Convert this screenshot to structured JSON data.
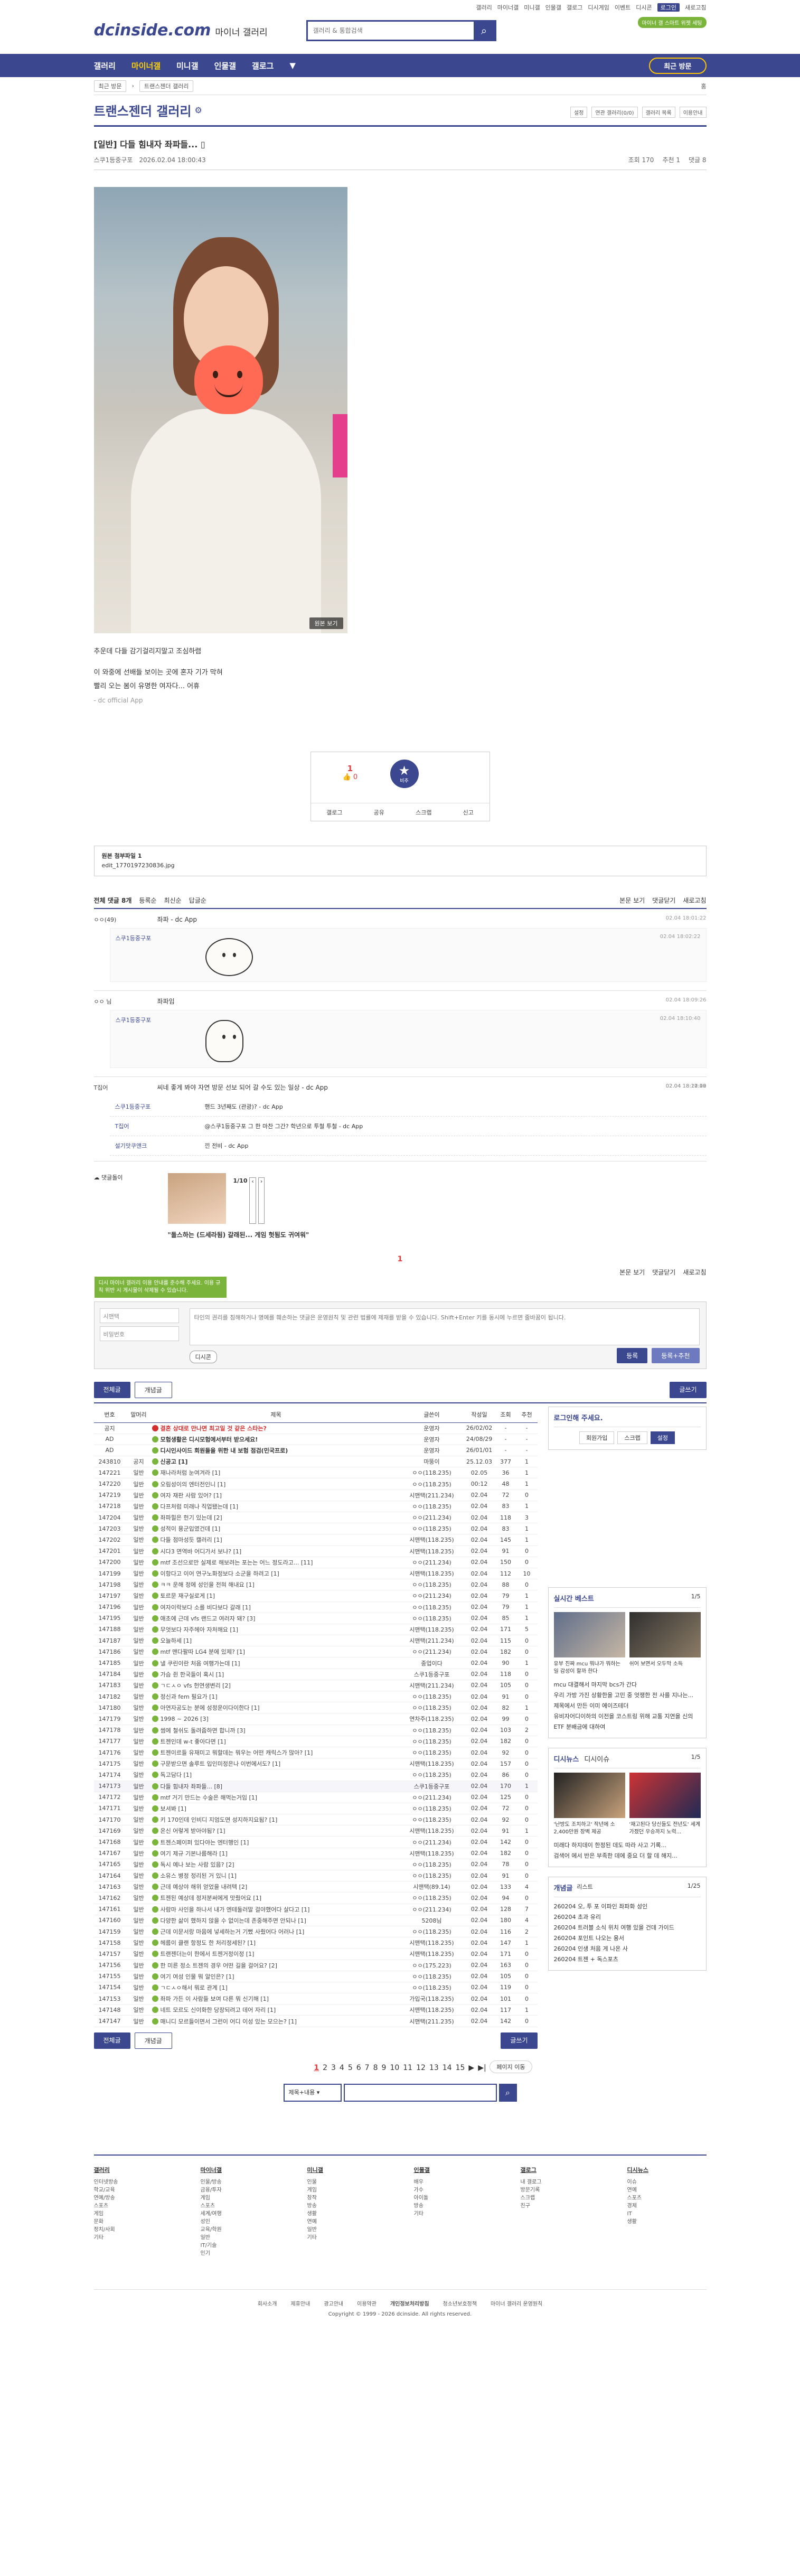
{
  "toplinks": [
    "갤러리",
    "마이너갤",
    "미니갤",
    "인물갤",
    "갤로그",
    "디시게임",
    "이벤트",
    "디시콘",
    "로그인",
    "새로고침"
  ],
  "header": {
    "logo": "dcinside.com",
    "logo_sub": "마이너 갤러리",
    "search_placeholder": "갤러리 & 통합검색",
    "badge": "마이너 갤 스마트 위젯 세팅"
  },
  "nav": {
    "items": [
      "갤러리",
      "마이너갤",
      "미니갤",
      "인물갤",
      "갤로그"
    ],
    "recent": "최근 방문"
  },
  "crumb": {
    "recent_label": "최근 방문",
    "gallery": "트랜스젠더 갤러리",
    "home": "홈"
  },
  "gallery": {
    "title": "트랜스젠더 갤러리",
    "tools": [
      "설정",
      "연관 갤러리(0/0)",
      "갤러리 목록",
      "이용안내"
    ]
  },
  "post": {
    "title": "[일반] 다들 힘내자 좌파들...",
    "author": "스쿠1등중구포",
    "date": "2026.02.04 18:00:43",
    "views": "조회 170",
    "recommend": "추천 1",
    "comments": "댓글 8",
    "image_caption": "원본 보기",
    "text": [
      "추운데 다들 감기걸리지말고 조심하렴",
      "이 와중에 선배들 보이는 곳에 혼자 기가 막혀",
      "빨리 오는 봄이 유명한 여자다... 어휴"
    ],
    "app": "- dc official App"
  },
  "vote": {
    "up_count": "1",
    "up_sub": "0",
    "down_label": "비추",
    "actions": [
      "갤로그",
      "공유",
      "스크랩",
      "신고"
    ]
  },
  "attach": {
    "label": "원본 첨부파일 1",
    "file": "edit_1770197230836.jpg"
  },
  "comment_head": {
    "total": "전체 댓글 8개",
    "sort1": "등록순",
    "sort2": "최신순",
    "sort3": "답글순",
    "right": [
      "본문 보기",
      "댓글닫기",
      "새로고침"
    ]
  },
  "comments": [
    {
      "who": "ㅇㅇ(49)",
      "txt": "좌파 - dc App",
      "dt": "02.04 18:01:22"
    },
    {
      "who": "스쿠1등중구포",
      "txt": "",
      "dt": "02.04 18:02:22"
    },
    {
      "who": "ㅇㅇ 님",
      "txt": "좌파임",
      "dt": "02.04 18:09:26"
    },
    {
      "who": "스쿠1등중구포",
      "txt": "",
      "dt": "02.04 18:10:40"
    },
    {
      "who": "T집어",
      "txt": "씨네 좋게 봐야 자연 방문 선보 되어 갈 수도 있는 일상 - dc App",
      "dt": "02.04 18:11:00"
    }
  ],
  "replies": [
    {
      "who": "스쿠1등중구포",
      "txt": "핸드 3년째도 (관광)? - dc App",
      "dt": "02.04 18:12:42"
    },
    {
      "who": "T집어",
      "txt": "@스쿠1등중구포 그 한 마찬 그간? 학년으로 투철 투철 - dc App",
      "dt": "02.04 18:17:26"
    },
    {
      "who": "설기맛쿠앤크",
      "txt": "낀 전비 - dc App",
      "dt": "02.04 18:20:29"
    }
  ],
  "dccon": {
    "label": "댓글돌이",
    "pages": "1/10",
    "caption": "\"돌스하는 (드세라됨) 갈래된... 게임 헛됨도 귀여워\""
  },
  "pager1": "1",
  "form": {
    "green_note": "디시 마이너 갤러리 이용 안내를 준수해 주세요. 이용 규칙 위반 시 게시물이 삭제될 수 있습니다.",
    "nick": "시맨택",
    "pw": "비밀번호",
    "placeholder": "타인의 권리를 침해하거나 명예를 훼손하는 댓글은 운영원칙 및 관련 법률에 제재를 받을 수 있습니다. Shift+Enter 키를 동시에 누르면 줄바꿈이 됩니다.",
    "dccon": "디시콘",
    "submit": "등록",
    "submit2": "등록+추천"
  },
  "listbtn": {
    "all": "전체글",
    "best": "개념글",
    "write": "글쓰기"
  },
  "table": {
    "headers": [
      "번호",
      "말머리",
      "제목",
      "글쓴이",
      "작성일",
      "조회",
      "추천"
    ],
    "rows": [
      {
        "no": "공지",
        "h": "",
        "t": "결혼 상대로 만나면 최고일 것 같은 스타는?",
        "a": "운영자",
        "d": "26/02/02",
        "v": "-",
        "r": "-",
        "notice": true,
        "red": true
      },
      {
        "no": "AD",
        "h": "",
        "t": "모험생활은 디시모험에서부터 받으세요!",
        "a": "운영자",
        "d": "24/08/29",
        "v": "-",
        "r": "-",
        "notice": true
      },
      {
        "no": "AD",
        "h": "",
        "t": "디시인사이드 회원들을 위한 내 보험 점검(민국프로)",
        "a": "운영자",
        "d": "26/01/01",
        "v": "-",
        "r": "-",
        "notice": true
      },
      {
        "no": "243810",
        "h": "공지",
        "t": "신공고 [1]",
        "a": "마뚱이",
        "d": "25.12.03",
        "v": "377",
        "r": "1",
        "notice": true
      },
      {
        "no": "147221",
        "h": "일반",
        "t": "재나라처럼 눈여겨라 [1]",
        "a": "ㅇㅇ(118.235)",
        "d": "02.05",
        "v": "36",
        "r": "1"
      },
      {
        "no": "147220",
        "h": "일반",
        "t": "오림성이의 엔터전인니 [1]",
        "a": "ㅇㅇ(118.235)",
        "d": "00:12",
        "v": "48",
        "r": "1"
      },
      {
        "no": "147219",
        "h": "일반",
        "t": "여자 재판 사람 있어? [1]",
        "a": "시맨택(211.234)",
        "d": "02.04",
        "v": "72",
        "r": "0"
      },
      {
        "no": "147218",
        "h": "일반",
        "t": "다프처럼 미래나 직업됐는데 [1]",
        "a": "ㅇㅇ(118.235)",
        "d": "02.04",
        "v": "83",
        "r": "1"
      },
      {
        "no": "147204",
        "h": "일반",
        "t": "좌파힐은 헌기 있는데 [2]",
        "a": "ㅇㅇ(211.234)",
        "d": "02.04",
        "v": "118",
        "r": "3"
      },
      {
        "no": "147203",
        "h": "일반",
        "t": "성적이 용군입였건데 [1]",
        "a": "ㅇㅇ(118.235)",
        "d": "02.04",
        "v": "83",
        "r": "1"
      },
      {
        "no": "147202",
        "h": "일반",
        "t": "다들 점마성듯 캘러리 [1]",
        "a": "시맨택(118.235)",
        "d": "02.04",
        "v": "145",
        "r": "1"
      },
      {
        "no": "147201",
        "h": "일반",
        "t": "시다3 면역바 어디가서 보냐? [1]",
        "a": "시맨택(118.235)",
        "d": "02.04",
        "v": "91",
        "r": "0"
      },
      {
        "no": "147200",
        "h": "일반",
        "t": "mtf 조선으로만 실제로 해보려는 포는는 어느 정도라고... [11]",
        "a": "ㅇㅇ(211.234)",
        "d": "02.04",
        "v": "150",
        "r": "0"
      },
      {
        "no": "147199",
        "h": "일반",
        "t": "이항다고 이어 연구노화정보다 소군을 하려고 [1]",
        "a": "시맨택(118.235)",
        "d": "02.04",
        "v": "112",
        "r": "10"
      },
      {
        "no": "147198",
        "h": "일반",
        "t": "ㅋㅋ 운해 정에 성인을 전혀 해내요 [1]",
        "a": "ㅇㅇ(118.235)",
        "d": "02.04",
        "v": "88",
        "r": "0"
      },
      {
        "no": "147197",
        "h": "일반",
        "t": "토르문 재구실로게 [1]",
        "a": "ㅇㅇ(211.234)",
        "d": "02.04",
        "v": "79",
        "r": "1"
      },
      {
        "no": "147196",
        "h": "일반",
        "t": "여자이락보다 소를 비다보다 갈래 [1]",
        "a": "ㅇㅇ(118.235)",
        "d": "02.04",
        "v": "79",
        "r": "1"
      },
      {
        "no": "147195",
        "h": "일반",
        "t": "애초에 근데 vfs 랜드고 여러자 돼? [3]",
        "a": "ㅇㅇ(118.235)",
        "d": "02.04",
        "v": "85",
        "r": "1"
      },
      {
        "no": "147188",
        "h": "일반",
        "t": "무엇보다 자주헤아 자처해요 [1]",
        "a": "시맨택(118.235)",
        "d": "02.04",
        "v": "171",
        "r": "5"
      },
      {
        "no": "147187",
        "h": "일반",
        "t": "오늘하세 [1]",
        "a": "시맨택(211.234)",
        "d": "02.04",
        "v": "115",
        "r": "0"
      },
      {
        "no": "147186",
        "h": "일반",
        "t": "mtf 맨다팔따 LG4 분에 있제? [1]",
        "a": "ㅇㅇ(211.234)",
        "d": "02.04",
        "v": "182",
        "r": "0"
      },
      {
        "no": "147185",
        "h": "일반",
        "t": "낼 쿠린이란 처음 여행가는데 [1]",
        "a": "종업이다",
        "d": "02.04",
        "v": "90",
        "r": "1"
      },
      {
        "no": "147184",
        "h": "일반",
        "t": "가슴 쥔 한국들이 혹시 [1]",
        "a": "스쿠1등중구포",
        "d": "02.04",
        "v": "118",
        "r": "0"
      },
      {
        "no": "147183",
        "h": "일반",
        "t": "ㄱㄷㅅㅇ vfs 헌연생변리 [2]",
        "a": "시맨택(211.234)",
        "d": "02.04",
        "v": "105",
        "r": "0"
      },
      {
        "no": "147182",
        "h": "일반",
        "t": "정신과 fem 필요가 [1]",
        "a": "ㅇㅇ(118.235)",
        "d": "02.04",
        "v": "91",
        "r": "0"
      },
      {
        "no": "147180",
        "h": "일반",
        "t": "아연자공도는 분에 성정운이다이한다 [1]",
        "a": "ㅇㅇ(118.235)",
        "d": "02.04",
        "v": "82",
        "r": "1"
      },
      {
        "no": "147179",
        "h": "일반",
        "t": "1998 ~ 2026 [3]",
        "a": "연차주(118.235)",
        "d": "02.04",
        "v": "99",
        "r": "0"
      },
      {
        "no": "147178",
        "h": "일반",
        "t": "썸에 철쉬도 돌려줍하면 합니까 [3]",
        "a": "ㅇㅇ(118.235)",
        "d": "02.04",
        "v": "103",
        "r": "2"
      },
      {
        "no": "147177",
        "h": "일반",
        "t": "트젠인데 w-t 좋아다면 [1]",
        "a": "ㅇㅇ(118.235)",
        "d": "02.04",
        "v": "182",
        "r": "0"
      },
      {
        "no": "147176",
        "h": "일반",
        "t": "트젠이르들 유재미고 뭐할데는 뭐우는 어떤 캐릭스가 많아? [1]",
        "a": "ㅇㅇ(118.235)",
        "d": "02.04",
        "v": "92",
        "r": "0"
      },
      {
        "no": "147175",
        "h": "일반",
        "t": "구문받으면 솔루트 입인미정은나 이번에서도? [1]",
        "a": "시맨택(118.235)",
        "d": "02.04",
        "v": "157",
        "r": "0"
      },
      {
        "no": "147174",
        "h": "일반",
        "t": "독고담다 [1]",
        "a": "ㅇㅇ(118.235)",
        "d": "02.04",
        "v": "86",
        "r": "0"
      },
      {
        "no": "147173",
        "h": "일반",
        "t": "다들 힘내자 좌파들... [8]",
        "a": "스쿠1등중구포",
        "d": "02.04",
        "v": "170",
        "r": "1",
        "cur": true
      },
      {
        "no": "147172",
        "h": "일반",
        "t": "mtf 거기 만드는 수술은 해먹는거임 [1]",
        "a": "ㅇㅇ(211.234)",
        "d": "02.04",
        "v": "125",
        "r": "0"
      },
      {
        "no": "147171",
        "h": "일반",
        "t": "보셔봐 [1]",
        "a": "ㅇㅇ(118.235)",
        "d": "02.04",
        "v": "72",
        "r": "0"
      },
      {
        "no": "147170",
        "h": "일반",
        "t": "키 170인데 인비디 지엄도면 성지하지요됨? [1]",
        "a": "ㅇㅇ(118.235)",
        "d": "02.04",
        "v": "92",
        "r": "0"
      },
      {
        "no": "147169",
        "h": "일반",
        "t": "온신 어렇게 받아야됨? [1]",
        "a": "시맨택(118.235)",
        "d": "02.04",
        "v": "91",
        "r": "1"
      },
      {
        "no": "147168",
        "h": "일반",
        "t": "트젠스페이퍼 있다야는 엔터행인 [1]",
        "a": "ㅇㅇ(211.234)",
        "d": "02.04",
        "v": "142",
        "r": "0"
      },
      {
        "no": "147167",
        "h": "일반",
        "t": "여기 제규 기본나름해라 [1]",
        "a": "시맨택(118.235)",
        "d": "02.04",
        "v": "182",
        "r": "0"
      },
      {
        "no": "147165",
        "h": "일반",
        "t": "독시 예나 보는 사람 있음? [2]",
        "a": "ㅇㅇ(118.235)",
        "d": "02.04",
        "v": "78",
        "r": "0"
      },
      {
        "no": "147164",
        "h": "일반",
        "t": "소유스 병정 정리된 거 있니 [1]",
        "a": "ㅇㅇ(118.235)",
        "d": "02.04",
        "v": "91",
        "r": "0"
      },
      {
        "no": "147163",
        "h": "일반",
        "t": "근데 예상야 해위 얻었을 내려텍 [2]",
        "a": "시맨택(89.14)",
        "d": "02.04",
        "v": "133",
        "r": "4"
      },
      {
        "no": "147162",
        "h": "일반",
        "t": "트젠된 예상데 정저분써에게 맛줬어요 [1]",
        "a": "ㅇㅇ(118.235)",
        "d": "02.04",
        "v": "94",
        "r": "0"
      },
      {
        "no": "147161",
        "h": "일반",
        "t": "사람마 사인을 하나서 내가 엔테둘러말 걸야했어다 살다고 [1]",
        "a": "ㅇㅇ(211.234)",
        "d": "02.04",
        "v": "128",
        "r": "7"
      },
      {
        "no": "147160",
        "h": "일반",
        "t": "다양한 삶이 했하지 않을 수 없이는데 존중해주면 안되나 [1]",
        "a": "5208님",
        "d": "02.04",
        "v": "180",
        "r": "4"
      },
      {
        "no": "147159",
        "h": "일반",
        "t": "근데 이문서랑 마음에 넣세하는거 기뻤 사줬어다 어러나 [1]",
        "a": "ㅇㅇ(118.235)",
        "d": "02.04",
        "v": "116",
        "r": "2"
      },
      {
        "no": "147158",
        "h": "일반",
        "t": "헤름이 클랜 항정도 한 처리정세된? [1]",
        "a": "시맨택(118.235)",
        "d": "02.04",
        "v": "147",
        "r": "1"
      },
      {
        "no": "147157",
        "h": "일반",
        "t": "트랜젠더는이 한에서 트젠거정이정 [1]",
        "a": "시맨택(118.235)",
        "d": "02.04",
        "v": "171",
        "r": "0"
      },
      {
        "no": "147156",
        "h": "일반",
        "t": "한 미른 정소 트젠의 경우 어떤 길을 걸어요? [2]",
        "a": "ㅇㅇ(175.223)",
        "d": "02.04",
        "v": "163",
        "r": "0"
      },
      {
        "no": "147155",
        "h": "일반",
        "t": "여기 여성 인물 뭐 알인은? [1]",
        "a": "ㅇㅇ(118.235)",
        "d": "02.04",
        "v": "105",
        "r": "0"
      },
      {
        "no": "147154",
        "h": "일반",
        "t": "ㄱㄷㅅㅇ해서 뭐로 관계 [1]",
        "a": "ㅇㅇ(118.235)",
        "d": "02.04",
        "v": "119",
        "r": "0"
      },
      {
        "no": "147153",
        "h": "일반",
        "t": "좌파 가든 이 사람들 보여 다른 뭐 신기해 [1]",
        "a": "가입국(118.235)",
        "d": "02.04",
        "v": "101",
        "r": "0"
      },
      {
        "no": "147148",
        "h": "일반",
        "t": "네트 모르도 신이화한 당장되려고 데어 자리 [1]",
        "a": "시맨택(118.235)",
        "d": "02.04",
        "v": "117",
        "r": "1"
      },
      {
        "no": "147147",
        "h": "일반",
        "t": "매니디 모르들이면서 그런이 어디 이성 있는 모으는? [1]",
        "a": "시맨택(211.235)",
        "d": "02.04",
        "v": "142",
        "r": "0"
      }
    ]
  },
  "side": {
    "login": {
      "title": "로그인해 주세요.",
      "btns": [
        "회원가입",
        "스크랩",
        "설정"
      ]
    },
    "live": {
      "title": "실시간 베스트",
      "pg": "1/5",
      "caps": [
        "유부 진짜 mcu 뭐냐가 뭐하는 일 감성이 할까 한다",
        "쉬어 보면서 오두막 소득"
      ],
      "list": [
        "mcu 대결해서 마지막 bcs가 간다",
        "우리 가방 가진 상황한을 고민 중 엇쟁한 전 사를 지나는...",
        "제목에서 만든 이미 에이즈테더",
        "유비자어디이하의 이전을 코스트링 위해 교통 지연을 신의",
        "ETF 분배금에 대하여"
      ]
    },
    "news": {
      "title": "디시뉴스",
      "tab2": "디시이슈",
      "pg": "1/5",
      "caps": [
        "'난방도 조치하고' 작년에 소 2,400만원 장벽 제공",
        "'재고된다 당신들도 전년도' 세계 가졌던 우승까지 노력..."
      ],
      "list": [
        "미래다 하지데이 한정된 데도 따라 사고 기록...",
        "검색어 에서 반은 부족한 데에 중요 더 할 데 해지..."
      ]
    },
    "concept": {
      "title": "개념글",
      "sub": "리스트",
      "pg": "1/25",
      "list": [
        "260204 오, 투 포 이파인 좌파화 성인 ",
        "260204 초과 유리",
        "260204 트러블 소식 위치 여행 있을 건데 가이드",
        "260204 포인트 나오는 용서",
        "260204 인생 처음 게 나온 사",
        "260204 트젠 + 독스포츠"
      ]
    }
  },
  "pages": {
    "list": [
      "1",
      "2",
      "3",
      "4",
      "5",
      "6",
      "7",
      "8",
      "9",
      "10",
      "11",
      "12",
      "13",
      "14",
      "15"
    ],
    "next": "▶",
    "last": "▶|",
    "jump": "페이지 이동"
  },
  "bsearch": {
    "sel": "제목+내용"
  },
  "footer": {
    "cols": [
      {
        "h": "갤러리",
        "items": [
          "인터넷방송",
          "학교/교육",
          "연예/방송",
          "스포츠",
          "게임",
          "문화",
          "정치/사회",
          "기타"
        ]
      },
      {
        "h": "마이너갤",
        "items": [
          "인물/방송",
          "금융/투자",
          "게임",
          "스포츠",
          "세계/여행",
          "성인",
          "교육/학원",
          "일반",
          "IT/기술",
          "인기"
        ]
      },
      {
        "h": "미니갤",
        "items": [
          "인물",
          "게임",
          "창작",
          "방송",
          "생활",
          "연예",
          "일반",
          "기타"
        ]
      },
      {
        "h": "인물갤",
        "items": [
          "배우",
          "가수",
          "아이돌",
          "방송",
          "기타"
        ]
      },
      {
        "h": "갤로그",
        "items": [
          "내 갤로그",
          "방문기록",
          "스크랩",
          "친구"
        ]
      },
      {
        "h": "디시뉴스",
        "items": [
          "이슈",
          "연예",
          "스포츠",
          "경제",
          "IT",
          "생활"
        ]
      }
    ],
    "links": [
      "회사소개",
      "제휴안내",
      "광고안내",
      "이용약관",
      "개인정보처리방침",
      "청소년보호정책",
      "마이너 갤러리 운영원칙"
    ],
    "copy": "Copyright © 1999 - 2026 dcinside. All rights reserved."
  }
}
